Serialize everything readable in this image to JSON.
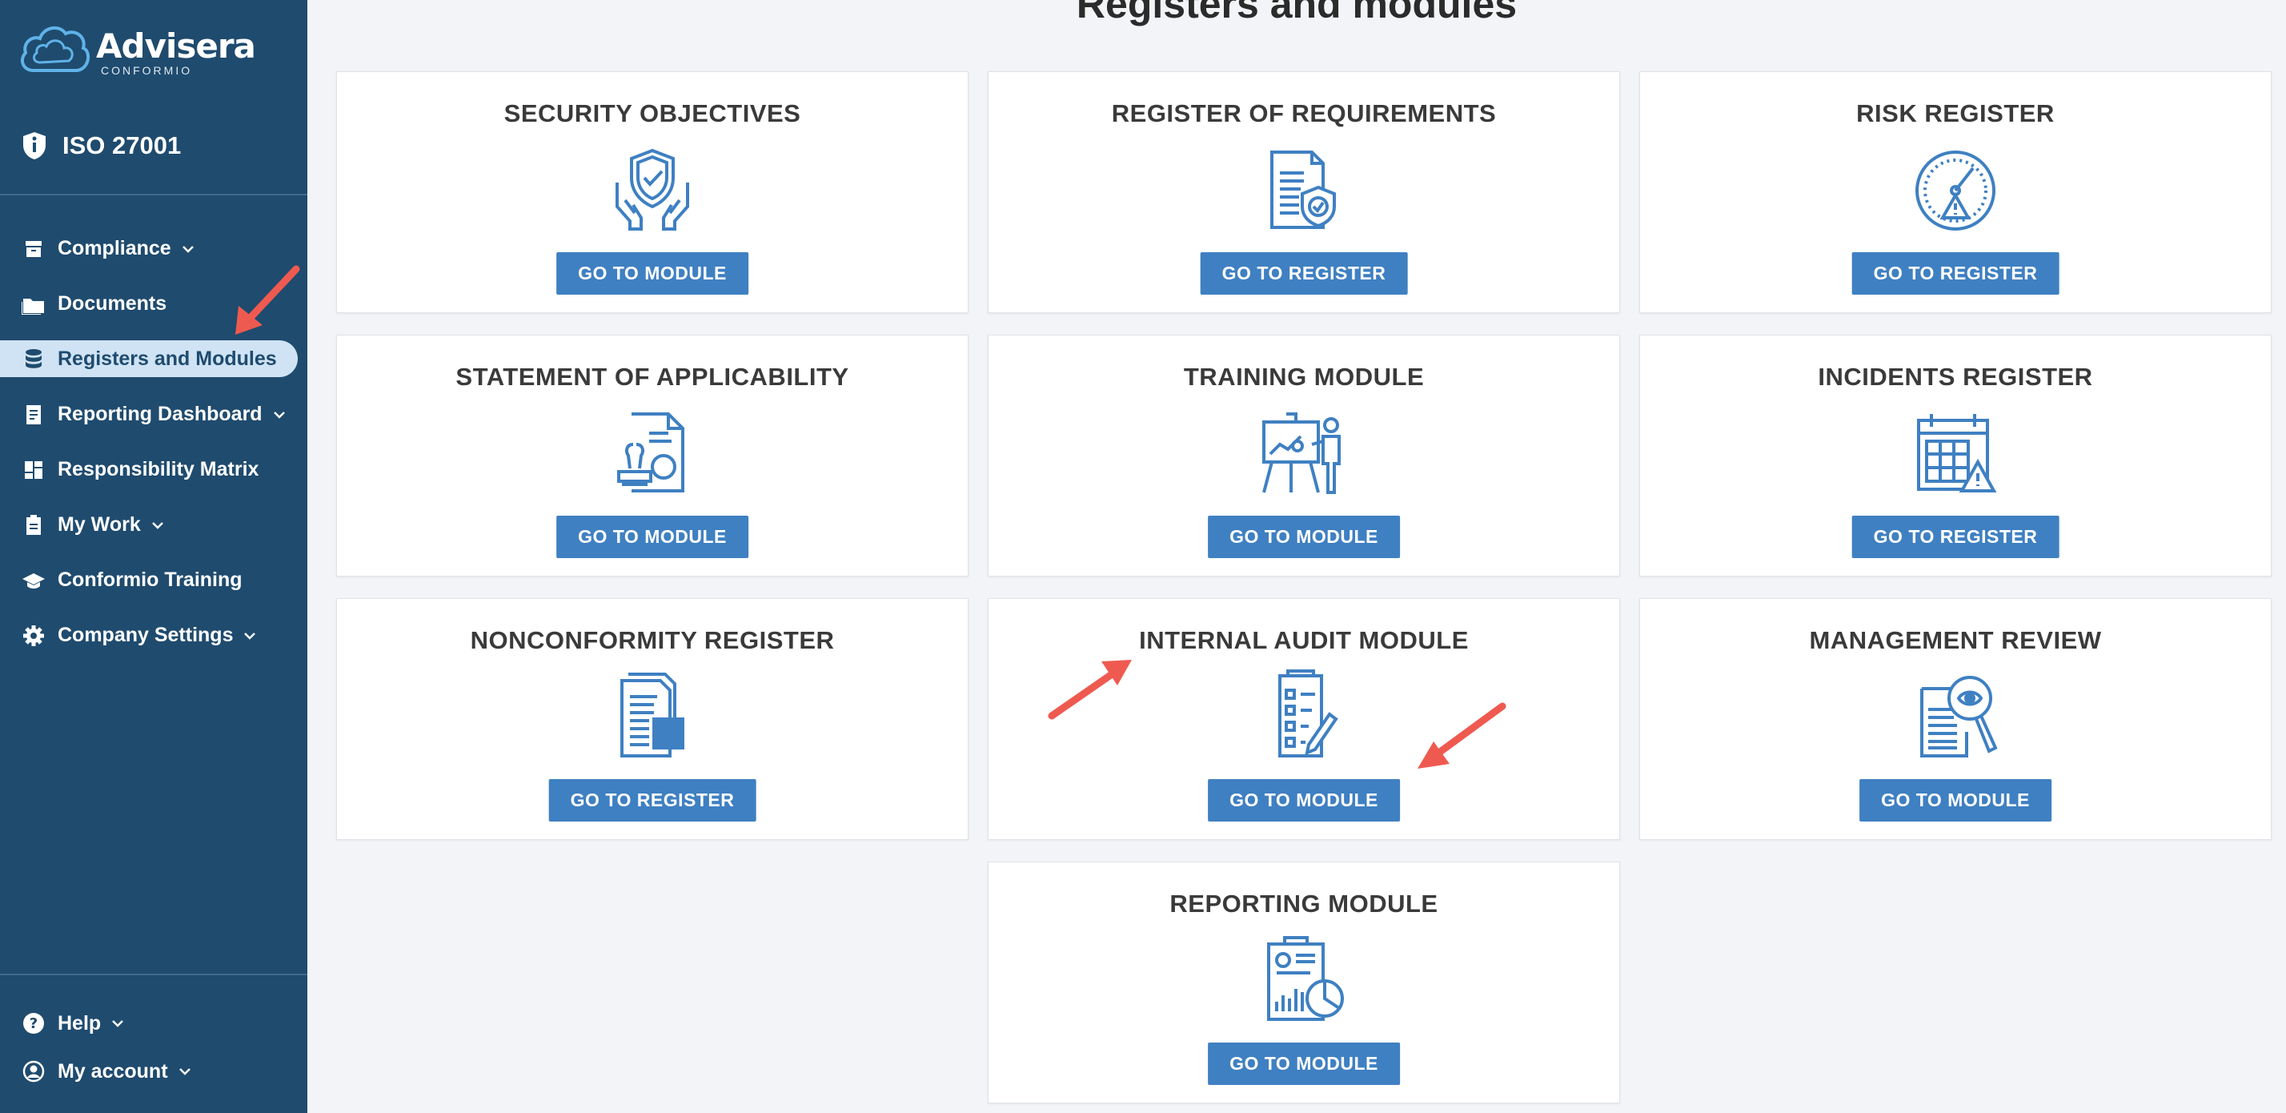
{
  "brand": {
    "name": "Advisera",
    "sub": "CONFORMIO"
  },
  "standard": {
    "label": "ISO 27001"
  },
  "sidebar": {
    "items": [
      {
        "label": "Compliance",
        "icon": "archive-icon",
        "dropdown": true
      },
      {
        "label": "Documents",
        "icon": "folder-icon",
        "dropdown": false
      },
      {
        "label": "Registers and Modules",
        "icon": "database-icon",
        "dropdown": false,
        "active": true
      },
      {
        "label": "Reporting Dashboard",
        "icon": "report-icon",
        "dropdown": true
      },
      {
        "label": "Responsibility Matrix",
        "icon": "dashboard-grid-icon",
        "dropdown": false
      },
      {
        "label": "My Work",
        "icon": "clipboard-icon",
        "dropdown": true
      },
      {
        "label": "Conformio Training",
        "icon": "graduation-cap-icon",
        "dropdown": false
      },
      {
        "label": "Company Settings",
        "icon": "gear-icon",
        "dropdown": true
      }
    ],
    "bottom": [
      {
        "label": "Help",
        "icon": "help-icon"
      },
      {
        "label": "My account",
        "icon": "user-circle-icon"
      }
    ]
  },
  "main": {
    "title": "Registers and modules",
    "cards": [
      {
        "title": "SECURITY OBJECTIVES",
        "button": "GO TO MODULE",
        "icon": "shield-hands-icon"
      },
      {
        "title": "REGISTER OF REQUIREMENTS",
        "button": "GO TO REGISTER",
        "icon": "document-shield-icon"
      },
      {
        "title": "RISK REGISTER",
        "button": "GO TO REGISTER",
        "icon": "risk-gauge-icon"
      },
      {
        "title": "STATEMENT OF APPLICABILITY",
        "button": "GO TO MODULE",
        "icon": "document-stamp-icon"
      },
      {
        "title": "TRAINING MODULE",
        "button": "GO TO MODULE",
        "icon": "presentation-icon"
      },
      {
        "title": "INCIDENTS REGISTER",
        "button": "GO TO REGISTER",
        "icon": "calendar-warning-icon"
      },
      {
        "title": "NONCONFORMITY REGISTER",
        "button": "GO TO REGISTER",
        "icon": "documents-stack-icon"
      },
      {
        "title": "INTERNAL AUDIT MODULE",
        "button": "GO TO MODULE",
        "icon": "checklist-pen-icon"
      },
      {
        "title": "MANAGEMENT REVIEW",
        "button": "GO TO MODULE",
        "icon": "document-magnifier-icon"
      },
      {
        "title": "REPORTING MODULE",
        "button": "GO TO MODULE",
        "icon": "report-chart-icon"
      }
    ]
  },
  "colors": {
    "sidebar": "#1f4b6e",
    "accent": "#3f80c2",
    "arrow": "#ef5a50"
  }
}
